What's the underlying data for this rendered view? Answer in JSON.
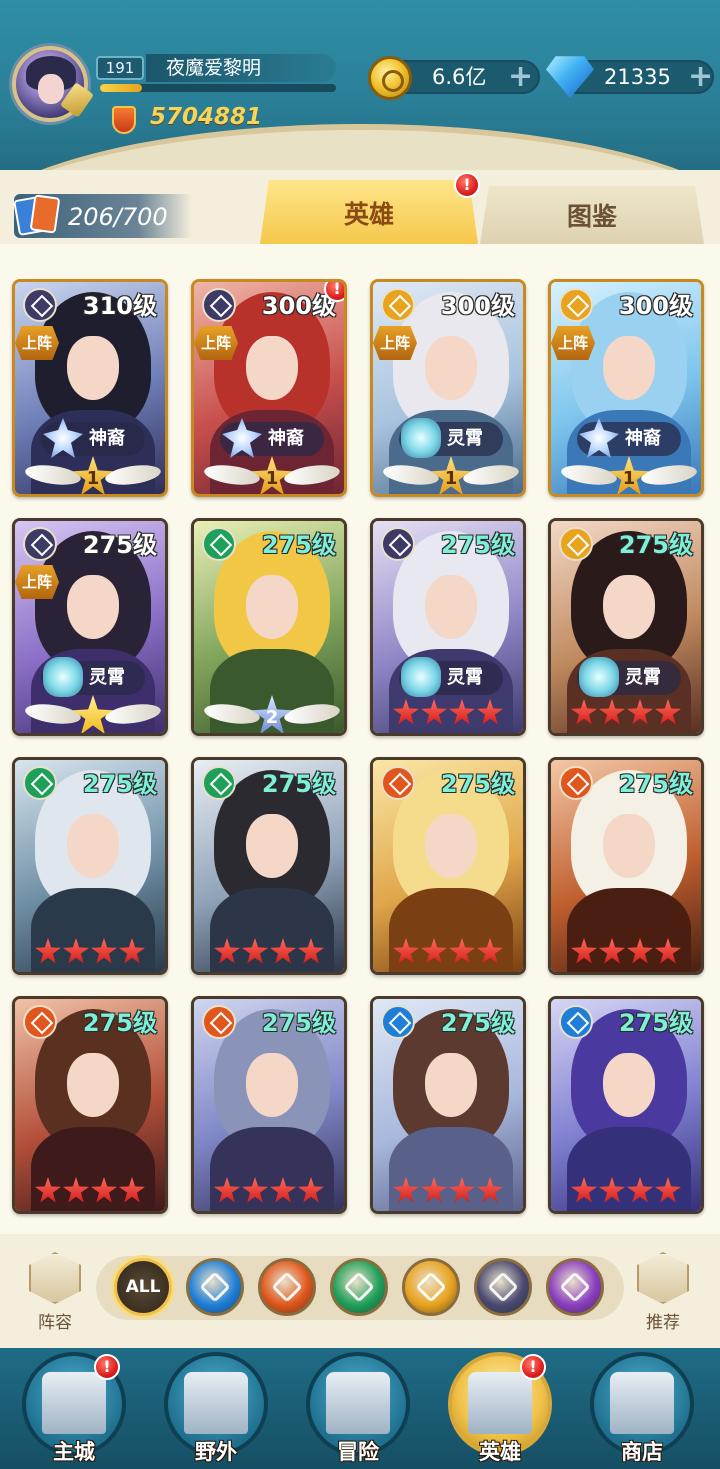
{
  "player": {
    "level": "191",
    "name": "夜魔爱黎明",
    "exp_fraction": 0.18,
    "power": "5704881"
  },
  "resources": {
    "gold": "6.6亿",
    "gems": "21335",
    "plus": "+"
  },
  "collection": {
    "count": "206/700"
  },
  "tabs": [
    {
      "label": "英雄",
      "active": true,
      "badge": "!"
    },
    {
      "label": "图鉴",
      "active": false
    }
  ],
  "heroes": [
    {
      "level": "310级",
      "deployed": "上阵",
      "rank": "神裔",
      "wing": "1",
      "element": "dark"
    },
    {
      "level": "300级",
      "deployed": "上阵",
      "rank": "神裔",
      "wing": "1",
      "element": "dark",
      "badge": "!"
    },
    {
      "level": "300级",
      "deployed": "上阵",
      "rank": "灵霄",
      "wing": "1",
      "element": "light"
    },
    {
      "level": "300级",
      "deployed": "上阵",
      "rank": "神裔",
      "wing": "1",
      "element": "light"
    },
    {
      "level": "275级",
      "deployed": "上阵",
      "rank": "灵霄",
      "wing": "",
      "element": "dark"
    },
    {
      "level": "275级",
      "rank": "",
      "wing": "2",
      "element": "wind"
    },
    {
      "level": "275级",
      "rank": "灵霄",
      "stars": 4,
      "element": "dark"
    },
    {
      "level": "275级",
      "rank": "灵霄",
      "stars": 4,
      "element": "light"
    },
    {
      "level": "275级",
      "stars": 4,
      "element": "wind"
    },
    {
      "level": "275级",
      "stars": 4,
      "element": "wind"
    },
    {
      "level": "275级",
      "stars": 4,
      "element": "fire"
    },
    {
      "level": "275级",
      "stars": 4,
      "element": "fire"
    },
    {
      "level": "275级",
      "stars": 4,
      "element": "fire"
    },
    {
      "level": "275级",
      "stars": 4,
      "element": "fire"
    },
    {
      "level": "275级",
      "stars": 4,
      "element": "water"
    },
    {
      "level": "275级",
      "stars": 4,
      "element": "water"
    }
  ],
  "filters": {
    "lineup_label": "阵容",
    "recommend_label": "推荐",
    "buttons": [
      {
        "label": "ALL",
        "icon": "all-icon",
        "color": "#2d2418"
      },
      {
        "icon": "water-element-icon",
        "color": "#1f7fd8"
      },
      {
        "icon": "fire-element-icon",
        "color": "#e0561c"
      },
      {
        "icon": "wind-element-icon",
        "color": "#1fa05a"
      },
      {
        "icon": "light-element-icon",
        "color": "#e8a31f"
      },
      {
        "icon": "dark-element-icon",
        "color": "#4a4a72"
      },
      {
        "icon": "void-element-icon",
        "color": "#8a3fc0"
      }
    ]
  },
  "nav": [
    {
      "label": "主城",
      "badge": "!"
    },
    {
      "label": "野外"
    },
    {
      "label": "冒险"
    },
    {
      "label": "英雄",
      "active": true,
      "badge": "!"
    },
    {
      "label": "商店"
    }
  ],
  "colors": {
    "element_dark": "#3d3a66",
    "element_light": "#e8a31f",
    "element_wind": "#1fa05a",
    "element_fire": "#e0561c",
    "element_water": "#1f7fd8"
  }
}
